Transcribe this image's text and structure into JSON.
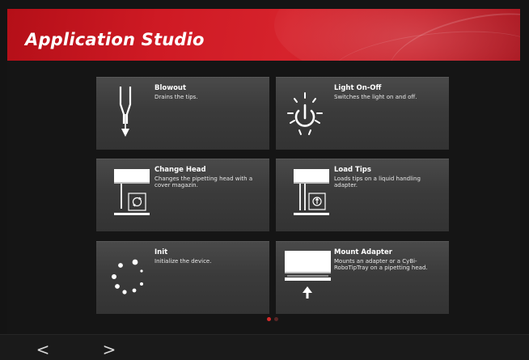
{
  "header": {
    "title": "Application Studio"
  },
  "tiles": [
    {
      "title": "Blowout",
      "description": "Drains the tips.",
      "icon": "blowout-tip-icon"
    },
    {
      "title": "Light On-Off",
      "description": "Switches the light on and off.",
      "icon": "light-power-icon"
    },
    {
      "title": "Change Head",
      "description": "Changes the pipetting head with a cover magazin.",
      "icon": "change-head-icon"
    },
    {
      "title": "Load Tips",
      "description": "Loads tips on a liquid handling adapter.",
      "icon": "load-tips-icon"
    },
    {
      "title": "Init",
      "description": "Initialize the device.",
      "icon": "loading-spinner-icon"
    },
    {
      "title": "Mount Adapter",
      "description": "Mounts an adapter or a CyBi-RoboTipTray on a pipetting head.",
      "icon": "mount-adapter-icon"
    }
  ],
  "pager": {
    "pages": 2,
    "active_page": 1
  },
  "nav": {
    "prev_label": "<",
    "next_label": ">"
  },
  "colors": {
    "brand_red": "#d0202a",
    "tile_bg": "#3d3d3d",
    "page_bg": "#151515",
    "dot_active": "#d42a2a",
    "dot_inactive": "#5a2626"
  }
}
